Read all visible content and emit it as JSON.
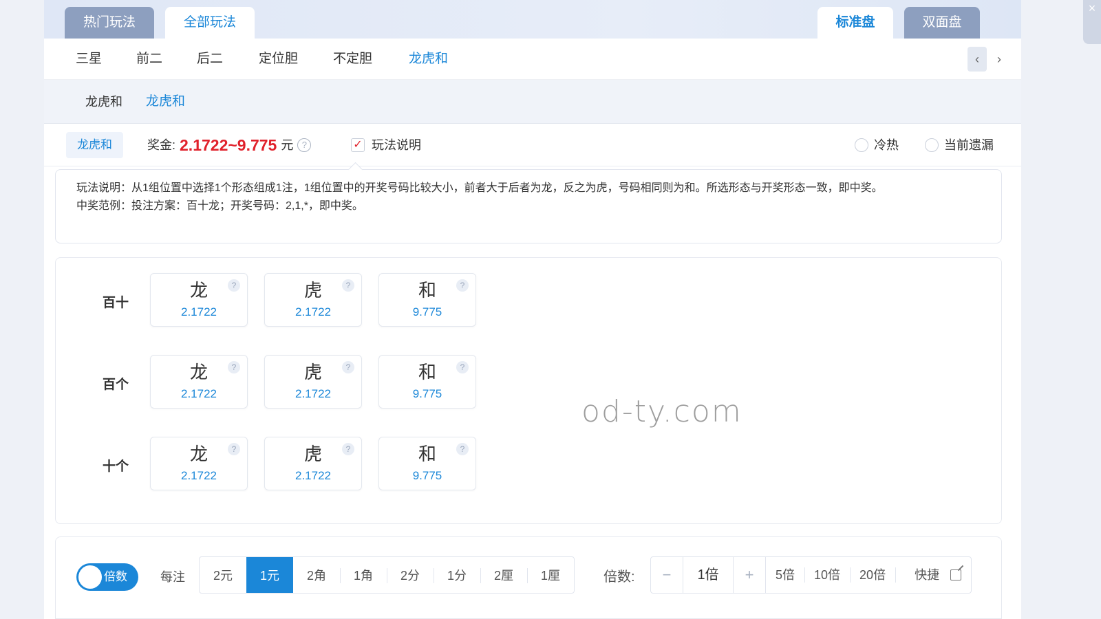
{
  "top_tabs": {
    "hot": "热门玩法",
    "all": "全部玩法",
    "standard": "标准盘",
    "double": "双面盘"
  },
  "subnav": {
    "items": [
      "三星",
      "前二",
      "后二",
      "定位胆",
      "不定胆",
      "龙虎和"
    ],
    "active_index": 5,
    "prev": "‹",
    "next": "›"
  },
  "subsub": {
    "items": [
      "龙虎和",
      "龙虎和"
    ],
    "active_index": 1
  },
  "info": {
    "play_name": "龙虎和",
    "bonus_label": "奖金:",
    "bonus_range": "2.1722~9.775",
    "bonus_unit": "元",
    "help_glyph": "?",
    "explain_toggle": "玩法说明",
    "explain_checked": true,
    "check_glyph": "✓",
    "radio_hot_cold": "冷热",
    "radio_missing": "当前遗漏"
  },
  "explanation": {
    "line1": "玩法说明：从1组位置中选择1个形态组成1注，1组位置中的开奖号码比较大小，前者大于后者为龙，反之为虎，号码相同则为和。所选形态与开奖形态一致，即中奖。",
    "line2": "中奖范例：投注方案：百十龙；开奖号码：2,1,*，即中奖。"
  },
  "bet_rows": [
    {
      "label": "百十",
      "options": [
        {
          "name": "龙",
          "odds": "2.1722"
        },
        {
          "name": "虎",
          "odds": "2.1722"
        },
        {
          "name": "和",
          "odds": "9.775"
        }
      ]
    },
    {
      "label": "百个",
      "options": [
        {
          "name": "龙",
          "odds": "2.1722"
        },
        {
          "name": "虎",
          "odds": "2.1722"
        },
        {
          "name": "和",
          "odds": "9.775"
        }
      ]
    },
    {
      "label": "十个",
      "options": [
        {
          "name": "龙",
          "odds": "2.1722"
        },
        {
          "name": "虎",
          "odds": "2.1722"
        },
        {
          "name": "和",
          "odds": "9.775"
        }
      ]
    }
  ],
  "watermark": "od-ty.com",
  "bottom": {
    "mode_toggle": "倍数",
    "per_bet_label": "每注",
    "units": [
      "2元",
      "1元",
      "2角",
      "1角",
      "2分",
      "1分",
      "2厘",
      "1厘"
    ],
    "unit_selected_index": 1,
    "multiplier_label": "倍数:",
    "minus": "−",
    "plus": "+",
    "multiplier_value": "1倍",
    "presets": [
      "5倍",
      "10倍",
      "20倍"
    ],
    "quick": "快捷"
  },
  "colors": {
    "accent": "#1b87d8",
    "bonus": "#e0212b",
    "tab_dark": "#8d9fbf"
  }
}
